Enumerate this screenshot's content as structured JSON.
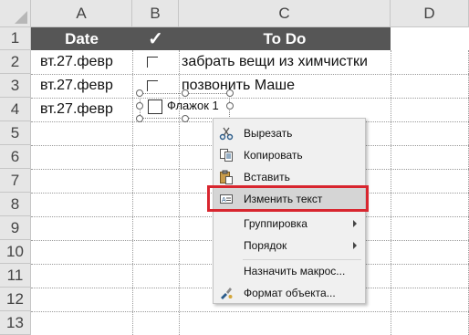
{
  "columns": [
    "A",
    "B",
    "C",
    "D"
  ],
  "rows": [
    "1",
    "2",
    "3",
    "4",
    "5",
    "6",
    "7",
    "8",
    "9",
    "10",
    "11",
    "12",
    "13"
  ],
  "header_row": {
    "date": "Date",
    "check": "✓",
    "todo": "To Do"
  },
  "data_rows": [
    {
      "date": "вт.27.февр",
      "todo": "забрать вещи из химчистки"
    },
    {
      "date": "вт.27.февр",
      "todo": "позвонить Маше"
    },
    {
      "date": "вт.27.февр",
      "todo": ""
    }
  ],
  "checkbox_control": {
    "label": "Флажок 1"
  },
  "context_menu": {
    "items": [
      {
        "label": "Вырезать",
        "icon": "scissors-icon"
      },
      {
        "label": "Копировать",
        "icon": "copy-icon"
      },
      {
        "label": "Вставить",
        "icon": "paste-icon"
      },
      {
        "label": "Изменить текст",
        "icon": "edit-text-icon",
        "highlighted": true
      },
      {
        "label": "Группировка",
        "submenu": true
      },
      {
        "label": "Порядок",
        "submenu": true
      },
      {
        "label": "Назначить макрос..."
      },
      {
        "label": "Формат объекта...",
        "icon": "format-object-icon"
      }
    ]
  },
  "colors": {
    "header_fill": "#565656",
    "highlight_border": "#d8262f",
    "menu_bg": "#f0f0f0"
  }
}
